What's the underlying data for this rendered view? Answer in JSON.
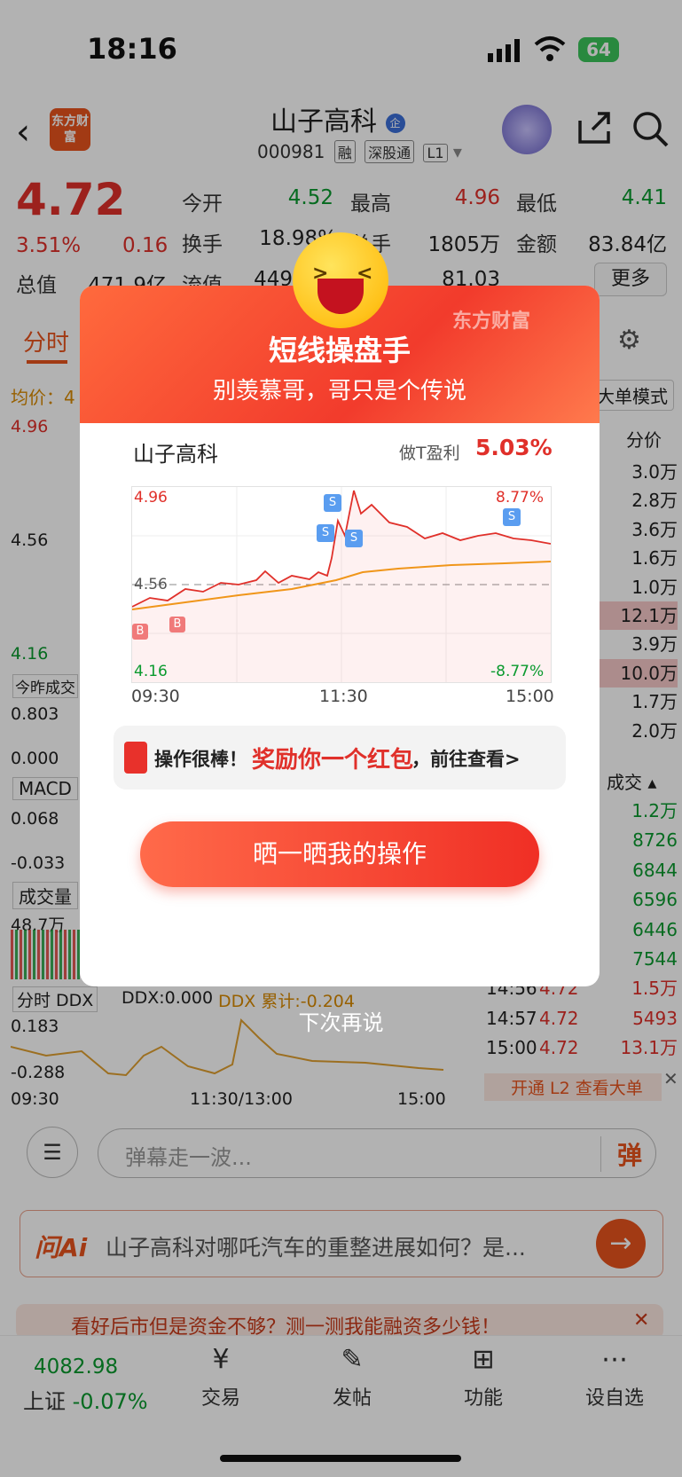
{
  "status": {
    "time": "18:16",
    "battery": "64"
  },
  "header": {
    "logo": "东方财富",
    "stock_name": "山子高科",
    "stock_code": "000981",
    "tags": [
      "融",
      "深股通",
      "L1"
    ]
  },
  "quote": {
    "price": "4.72",
    "change_pct": "3.51%",
    "change": "0.16",
    "rows": [
      [
        {
          "l": "今开",
          "v": "4.52",
          "c": "green"
        },
        {
          "l": "最高",
          "v": "4.96",
          "c": "red"
        },
        {
          "l": "最低",
          "v": "4.41",
          "c": "green"
        }
      ],
      [
        {
          "l": "换手",
          "v": "18.98%",
          "c": ""
        },
        {
          "l": "总手",
          "v": "1805万",
          "c": ""
        },
        {
          "l": "金额",
          "v": "83.84亿",
          "c": ""
        }
      ],
      [
        {
          "l": "总值",
          "v": "471.9亿",
          "c": ""
        },
        {
          "l": "流值",
          "v": "449",
          "c": ""
        },
        {
          "l": "",
          "v": "81.03",
          "c": ""
        }
      ]
    ],
    "more": "更多"
  },
  "tabs": {
    "active": "分时"
  },
  "background": {
    "avg_label": "均价：4",
    "hi": "4.96",
    "mid": "4.56",
    "lo": "4.16",
    "vol_lbl": "今昨成交",
    "v1": "0.803",
    "v2": "0.000",
    "macd": "MACD",
    "macd_v1": "0.068",
    "macd_v2": "-0.033",
    "vol": "成交量",
    "vol_v": "48.7万",
    "ddx_tab": "分时 DDX",
    "ddx": "DDX:0.000",
    "ddx_sum": "DDX 累计:-0.204",
    "ddx_v1": "0.183",
    "ddx_v2": "-0.288",
    "times": [
      "09:30",
      "11:30/13:00",
      "15:00"
    ],
    "mode": "大单模式",
    "price_col": "分价",
    "right_prices": [
      "3.0万",
      "2.8万",
      "3.6万",
      "1.6万",
      "1.0万",
      "12.1万",
      "3.9万",
      "10.0万",
      "1.7万",
      "2.0万"
    ],
    "trade_head": "成交",
    "trades": [
      {
        "t": "",
        "p": "",
        "v": "1.2万"
      },
      {
        "t": "",
        "p": "",
        "v": "8726"
      },
      {
        "t": "",
        "p": "",
        "v": "6844"
      },
      {
        "t": "",
        "p": "",
        "v": "6596"
      },
      {
        "t": "",
        "p": "",
        "v": "6446"
      },
      {
        "t": "",
        "p": "",
        "v": "7544"
      },
      {
        "t": "14:56",
        "p": "4.72",
        "v": "1.5万"
      },
      {
        "t": "14:57",
        "p": "4.72",
        "v": "5493"
      },
      {
        "t": "15:00",
        "p": "4.72",
        "v": "13.1万"
      }
    ],
    "l2": "开通 L2 查看大单"
  },
  "input": {
    "placeholder": "弹幕走一波...",
    "danmu_btn": "弹"
  },
  "ask": {
    "brand": "问Ai",
    "question": "山子高科对哪吒汽车的重整进展如何？是..."
  },
  "promo": "看好后市但是资金不够？测一测我能融资多少钱！",
  "bottom": {
    "index_value": "4082.98",
    "index_name": "上证",
    "index_change": "-0.07%",
    "items": [
      "交易",
      "发帖",
      "功能",
      "设自选"
    ]
  },
  "modal": {
    "brand": "东方财富",
    "title": "短线操盘手",
    "subtitle": "别羡慕哥，哥只是个传说",
    "stock": "山子高科",
    "profit_label": "做T盈利",
    "profit": "5.03%",
    "y_hi": "4.96",
    "y_mid": "4.56",
    "y_lo": "4.16",
    "pct_hi": "8.77%",
    "pct_lo": "-8.77%",
    "times": [
      "09:30",
      "11:30",
      "15:00"
    ],
    "rp_1": "操作很棒！",
    "rp_2": "奖励你一个红包",
    "rp_3": "，前往查看>",
    "share": "晒一晒我的操作",
    "later": "下次再说"
  }
}
